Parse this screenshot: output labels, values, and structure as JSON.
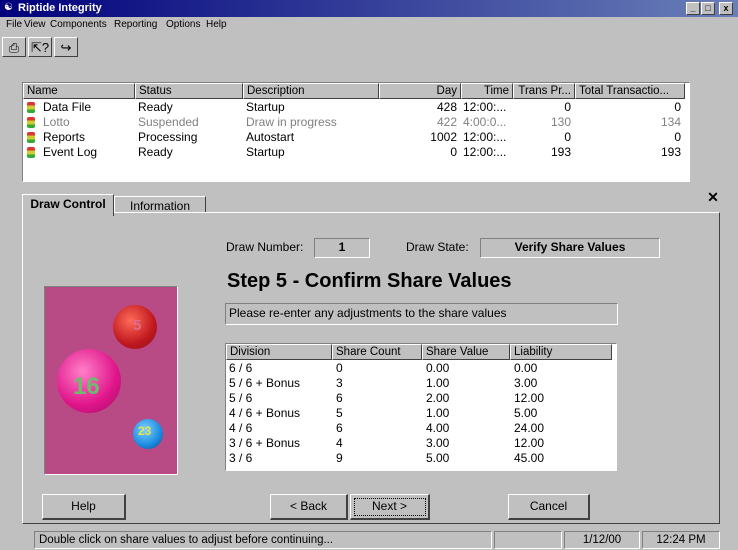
{
  "window": {
    "title": "Riptide Integrity",
    "controls": [
      "_",
      "□",
      "x"
    ]
  },
  "menu": [
    "File",
    "View",
    "Components",
    "Reporting",
    "Options",
    "Help"
  ],
  "toolbar": {
    "icons": [
      "printer-icon",
      "help-pointer-icon",
      "exit-icon"
    ]
  },
  "process_list": {
    "columns": [
      "Name",
      "Status",
      "Description",
      "Day",
      "Time",
      "Trans Pr...",
      "Total Transactio..."
    ],
    "rows": [
      {
        "name": "Data File",
        "status": "Ready",
        "description": "Startup",
        "day": "428",
        "time": "12:00:...",
        "trans": "0",
        "total": "0",
        "color": "#000000"
      },
      {
        "name": "Lotto",
        "status": "Suspended",
        "description": "Draw in progress",
        "day": "422",
        "time": "4:00:0...",
        "trans": "130",
        "total": "134",
        "color": "#808080"
      },
      {
        "name": "Reports",
        "status": "Processing",
        "description": "Autostart",
        "day": "1002",
        "time": "12:00:...",
        "trans": "0",
        "total": "0",
        "color": "#000000"
      },
      {
        "name": "Event Log",
        "status": "Ready",
        "description": "Startup",
        "day": "0",
        "time": "12:00:...",
        "trans": "193",
        "total": "193",
        "color": "#000000"
      }
    ]
  },
  "tabs": [
    "Draw Control",
    "Information"
  ],
  "draw": {
    "number_label": "Draw Number:",
    "number": "1",
    "state_label": "Draw State:",
    "state": "Verify Share Values",
    "step_title": "Step 5 - Confirm Share Values",
    "instruction": "Please re-enter any adjustments to the share values"
  },
  "balls": [
    "5",
    "16",
    "23"
  ],
  "share_table": {
    "columns": [
      "Division",
      "Share Count",
      "Share Value",
      "Liability"
    ],
    "rows": [
      [
        "6 / 6",
        "0",
        "0.00",
        "0.00"
      ],
      [
        "5 / 6 + Bonus",
        "3",
        "1.00",
        "3.00"
      ],
      [
        "5 / 6",
        "6",
        "2.00",
        "12.00"
      ],
      [
        "4 / 6 + Bonus",
        "5",
        "1.00",
        "5.00"
      ],
      [
        "4 / 6",
        "6",
        "4.00",
        "24.00"
      ],
      [
        "3 / 6 + Bonus",
        "4",
        "3.00",
        "12.00"
      ],
      [
        "3 / 6",
        "9",
        "5.00",
        "45.00"
      ]
    ]
  },
  "buttons": {
    "help": "Help",
    "back": "< Back",
    "next": "Next >",
    "cancel": "Cancel"
  },
  "status": {
    "message": "Double click on share values to adjust before continuing...",
    "date": "1/12/00",
    "time": "12:24 PM"
  }
}
